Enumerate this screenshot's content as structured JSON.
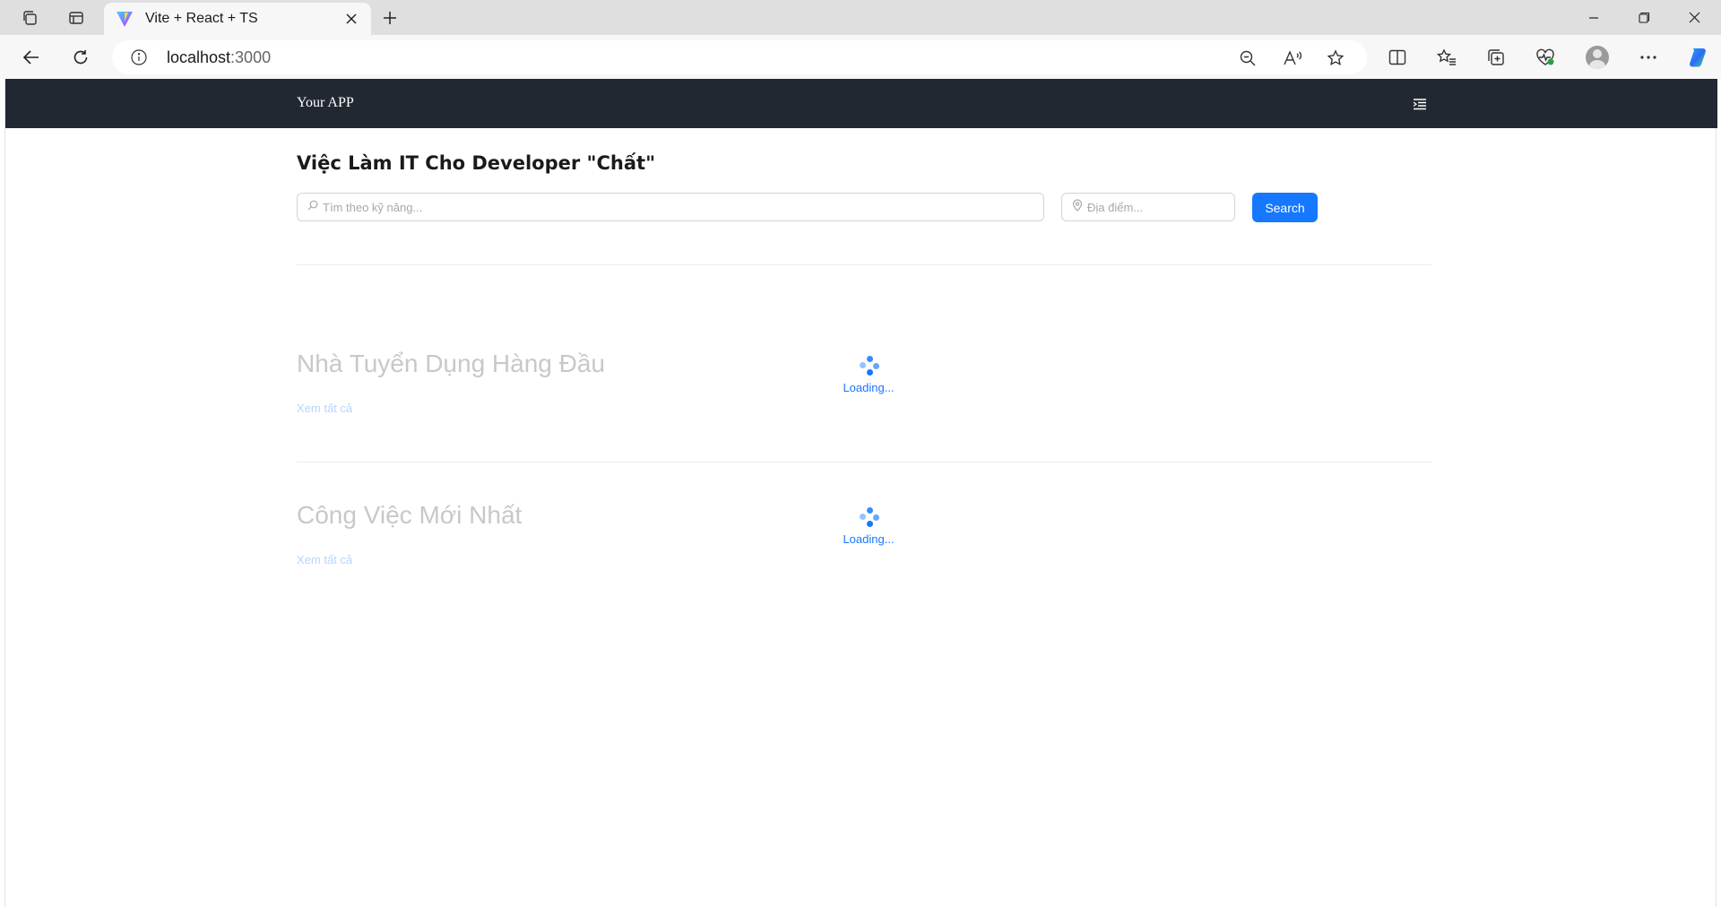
{
  "browser": {
    "tab_title": "Vite + React + TS",
    "url_host": "localhost",
    "url_port": ":3000"
  },
  "app": {
    "brand": "Your APP",
    "hero_title": "Việc Làm IT Cho Developer \"Chất\"",
    "search": {
      "skill_placeholder": "Tìm theo kỹ năng...",
      "location_placeholder": "Địa điểm...",
      "button_label": "Search"
    },
    "sections": [
      {
        "title": "Nhà Tuyển Dụng Hàng Đầu",
        "see_all": "Xem tất cả",
        "loading": "Loading..."
      },
      {
        "title": "Công Việc Mới Nhất",
        "see_all": "Xem tất cả",
        "loading": "Loading..."
      }
    ]
  },
  "colors": {
    "header_bg": "#222831",
    "accent": "#1677ff",
    "link_faded": "#b7d4fb",
    "section_title_faded": "#c8c8c8"
  }
}
